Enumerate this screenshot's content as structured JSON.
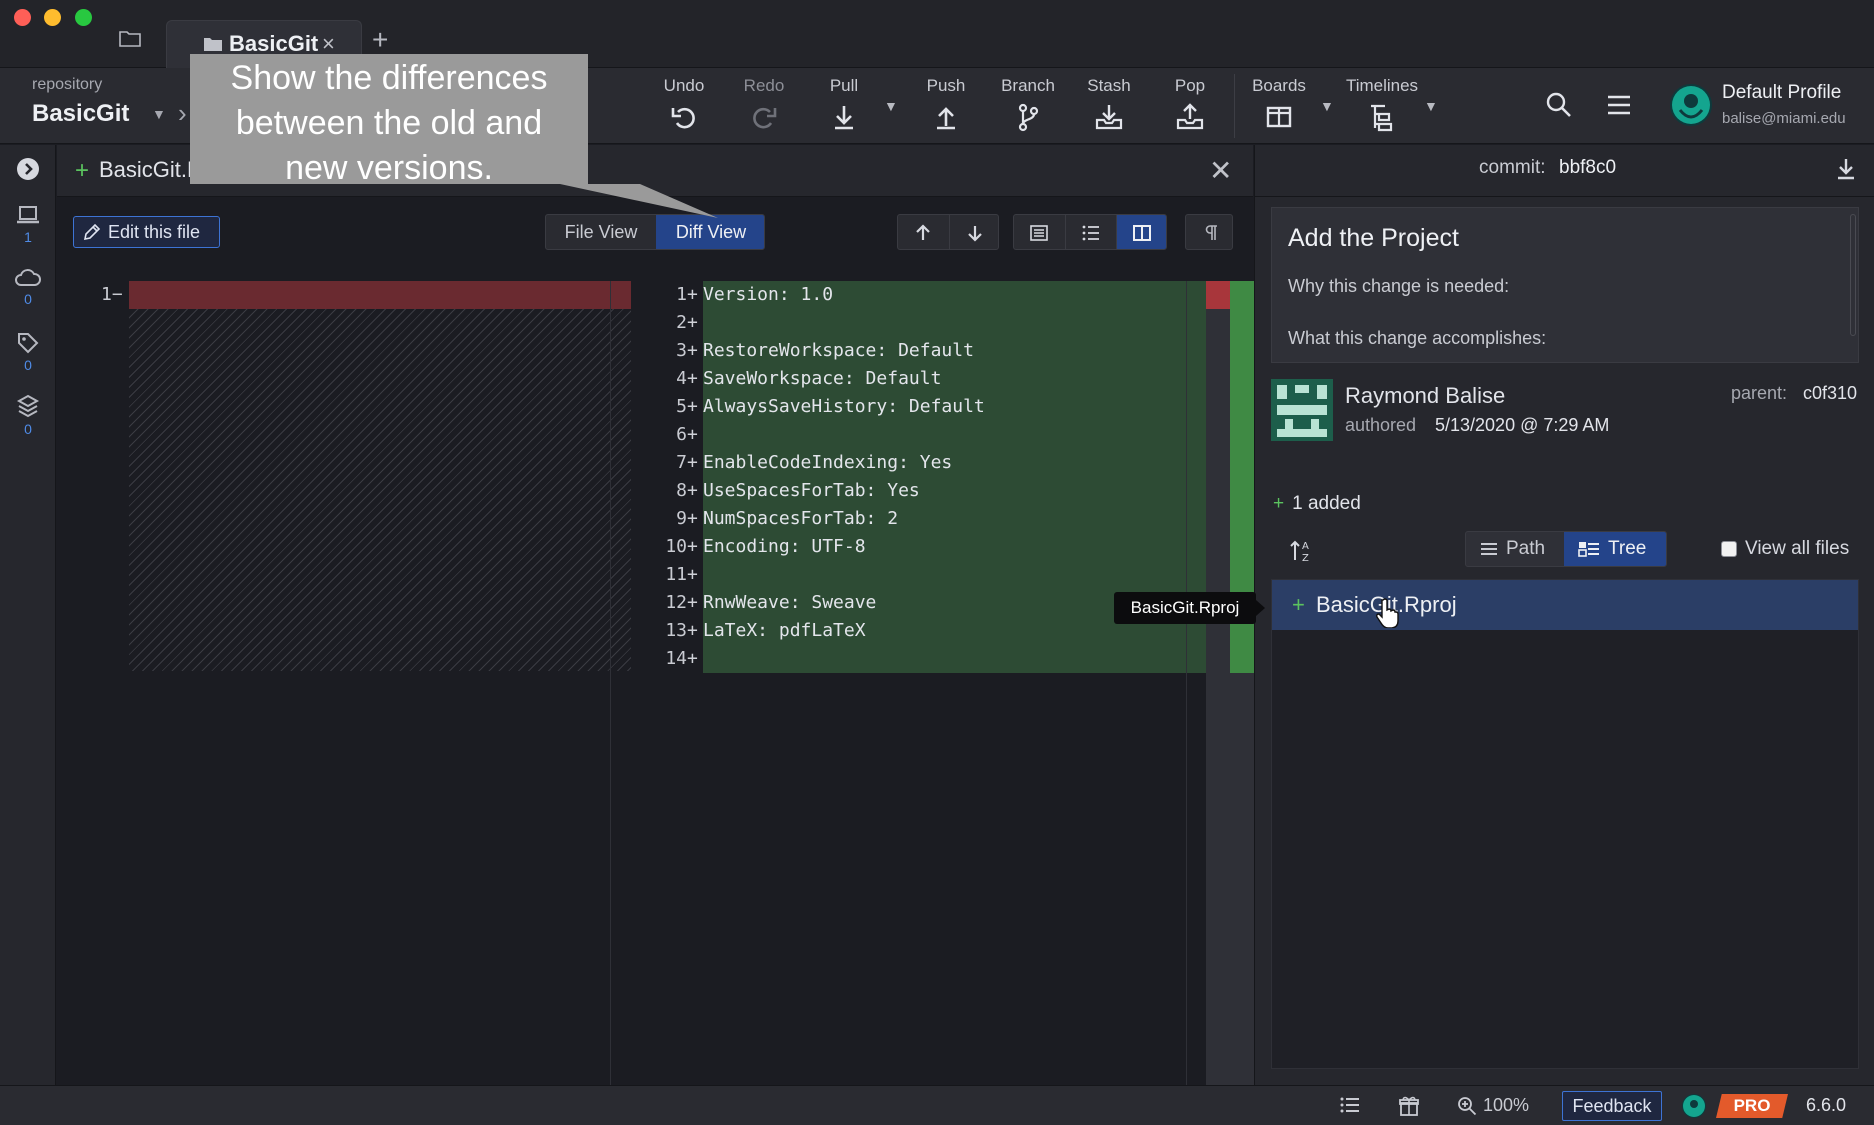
{
  "window": {
    "tab_label": "BasicGit",
    "tab_close": "×",
    "new_tab": "+"
  },
  "toolbar": {
    "repo_label": "repository",
    "repo_name": "BasicGit",
    "buttons": {
      "undo": "Undo",
      "redo": "Redo",
      "pull": "Pull",
      "push": "Push",
      "branch": "Branch",
      "stash": "Stash",
      "pop": "Pop",
      "boards": "Boards",
      "timelines": "Timelines"
    },
    "profile_name": "Default Profile",
    "profile_email": "balise@miami.edu"
  },
  "left_rail": {
    "local_count": "1",
    "remote_count": "0",
    "tags_count": "0",
    "stashes_count": "0"
  },
  "diff": {
    "file_name": "BasicGit.Rproj",
    "edit_button": "Edit this file",
    "file_view": "File View",
    "diff_view": "Diff View",
    "old_line_number": "1",
    "old_line_marker": "−",
    "new_lines": [
      {
        "n": "1",
        "mk": "+",
        "text": "Version: 1.0"
      },
      {
        "n": "2",
        "mk": "+",
        "text": ""
      },
      {
        "n": "3",
        "mk": "+",
        "text": "RestoreWorkspace: Default"
      },
      {
        "n": "4",
        "mk": "+",
        "text": "SaveWorkspace: Default"
      },
      {
        "n": "5",
        "mk": "+",
        "text": "AlwaysSaveHistory: Default"
      },
      {
        "n": "6",
        "mk": "+",
        "text": ""
      },
      {
        "n": "7",
        "mk": "+",
        "text": "EnableCodeIndexing: Yes"
      },
      {
        "n": "8",
        "mk": "+",
        "text": "UseSpacesForTab: Yes"
      },
      {
        "n": "9",
        "mk": "+",
        "text": "NumSpacesForTab: 2"
      },
      {
        "n": "10",
        "mk": "+",
        "text": "Encoding: UTF-8"
      },
      {
        "n": "11",
        "mk": "+",
        "text": ""
      },
      {
        "n": "12",
        "mk": "+",
        "text": "RnwWeave: Sweave"
      },
      {
        "n": "13",
        "mk": "+",
        "text": "LaTeX: pdfLaTeX"
      },
      {
        "n": "14",
        "mk": "+",
        "text": ""
      }
    ]
  },
  "callout": {
    "line1": "Show the differences",
    "line2": "between the old and",
    "line3": "new versions."
  },
  "commit": {
    "label": "commit:",
    "sha": "bbf8c0",
    "title": "Add the Project",
    "line1": "Why this change is needed:",
    "line2": "What this change accomplishes:",
    "author": "Raymond Balise",
    "authored_label": "authored",
    "authored_date": "5/13/2020 @ 7:29 AM",
    "parent_label": "parent:",
    "parent_sha": "c0f310",
    "added_summary": "1 added",
    "path_label": "Path",
    "tree_label": "Tree",
    "view_all_label": "View all files",
    "files": [
      {
        "name": "BasicGit.Rproj",
        "status": "added"
      }
    ],
    "tooltip": "BasicGit.Rproj"
  },
  "statusbar": {
    "zoom": "100%",
    "feedback": "Feedback",
    "pro": "PRO",
    "version": "6.6.0"
  },
  "colors": {
    "accent": "#24448a",
    "added": "#2d4b34",
    "removed": "#6a2a30",
    "plus": "#5bc35f",
    "pro": "#e35a2b"
  }
}
